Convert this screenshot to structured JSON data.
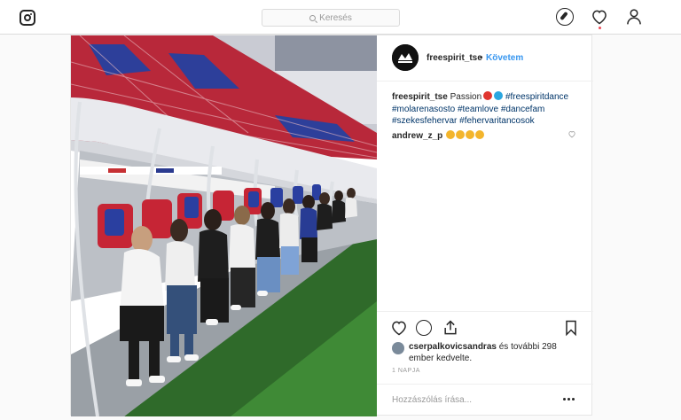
{
  "search": {
    "placeholder": "Keresés"
  },
  "post": {
    "username": "freespirit_tse",
    "separator": "•",
    "follow_label": "Követem",
    "caption": {
      "username": "freespirit_tse",
      "text": "Passion",
      "tags": [
        "#freespiritdance",
        "#molarenasosto",
        "#teamlove",
        "#dancefam",
        "#szekesfehervar",
        "#fehervaritancosok"
      ]
    },
    "comment": {
      "username": "andrew_z_p"
    },
    "likes": {
      "username": "cserpalkovicsandras",
      "rest": "és további 298 ember kedvelte."
    },
    "time_ago": "1 NAPJA",
    "add_comment_placeholder": "Hozzászólás írása..."
  },
  "icons": {
    "logo": "instagram-logo-icon",
    "search": "search-icon",
    "explore": "compass-icon",
    "activity": "heart-icon",
    "profile": "person-icon",
    "like": "heart-icon",
    "comment": "comment-bubble-icon",
    "share": "share-icon",
    "save": "bookmark-icon",
    "options": "more-options-icon"
  },
  "colors": {
    "link_blue": "#3897f0",
    "hashtag": "#003569",
    "notification": "#ed4956"
  }
}
